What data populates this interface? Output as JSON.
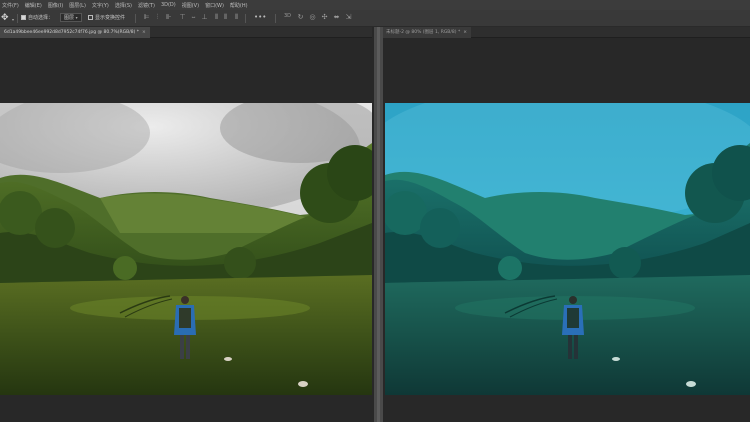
{
  "menu": {
    "items": [
      "文件(F)",
      "编辑(E)",
      "图像(I)",
      "图层(L)",
      "文字(Y)",
      "选择(S)",
      "滤镜(T)",
      "3D(D)",
      "视图(V)",
      "窗口(W)",
      "帮助(H)"
    ]
  },
  "options": {
    "auto_select_label": "自动选择：",
    "auto_select_value": "图层",
    "show_transform_label": "显示变换控件",
    "more_label": "•••"
  },
  "tabs": {
    "left_label": "6d1a49bbee46ee992d8d7952c74f76.jpg @ 80.7%(RGB/8) *",
    "left_close": "×",
    "right_label": "未标题-2 @ 80% (图层 1, RGB/8) *",
    "right_close": "×"
  },
  "icons": {
    "move_tool": "move-icon",
    "align": [
      "align-left-icon",
      "align-hcenter-icon",
      "align-right-icon",
      "align-top-icon",
      "align-vcenter-icon",
      "align-bottom-icon"
    ],
    "distribute": [
      "distribute-left-icon",
      "distribute-hcenter-icon",
      "distribute-right-icon",
      "distribute-top-icon",
      "distribute-vcenter-icon",
      "distribute-bottom-icon",
      "auto-align-icon"
    ],
    "mode_3d": [
      "rotate-3d-icon",
      "roll-3d-icon",
      "drag-3d-icon",
      "slide-3d-icon",
      "scale-3d-icon"
    ]
  },
  "colors": {
    "menubar_bg": "#3c3c3c",
    "workspace_bg": "#282828",
    "original_sky": "#d9d9d9",
    "edited_sky": "#2fa7c8"
  }
}
